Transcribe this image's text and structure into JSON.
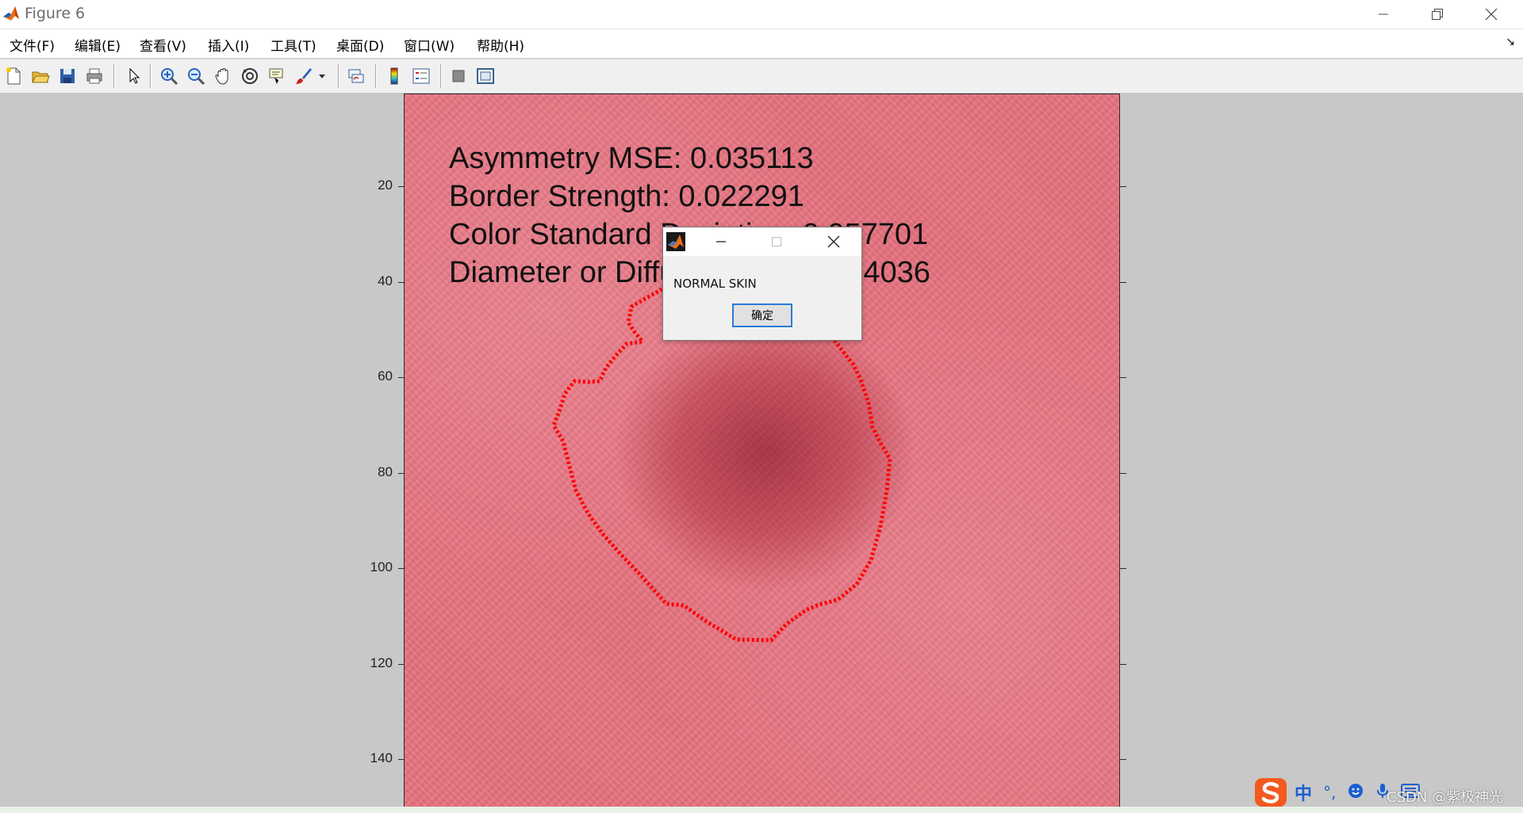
{
  "window": {
    "title": "Figure 6",
    "controls": [
      "minimize",
      "restore",
      "close"
    ]
  },
  "menu": {
    "items": [
      "文件(F)",
      "编辑(E)",
      "查看(V)",
      "插入(I)",
      "工具(T)",
      "桌面(D)",
      "窗口(W)",
      "帮助(H)"
    ],
    "dock_glyph": "↘"
  },
  "toolbar": {
    "icons": [
      "new-figure-icon",
      "open-file-icon",
      "save-icon",
      "print-icon",
      "edit-plot-arrow-icon",
      "zoom-in-icon",
      "zoom-out-icon",
      "pan-hand-icon",
      "rotate-3d-icon",
      "data-cursor-icon",
      "brush-icon",
      "brush-dropdown-icon",
      "link-plot-icon",
      "colorbar-icon",
      "legend-icon",
      "hide-plot-tools-icon",
      "show-plot-tools-icon"
    ]
  },
  "figure": {
    "overlay_lines": [
      "Asymmetry MSE: 0.035113",
      "Border Strength: 0.022291",
      "Color Standard Deviation: 0.057701",
      "Diameter or Diffusion Texture1.4036"
    ],
    "y_ticks": [
      "20",
      "40",
      "60",
      "80",
      "100",
      "120",
      "140"
    ],
    "y_tick_values": [
      20,
      40,
      60,
      80,
      100,
      120,
      140
    ],
    "boundary_color": "#ff0000"
  },
  "dialog": {
    "message": "NORMAL SKIN",
    "ok_label": "确定"
  },
  "ime": {
    "mode_label": "中",
    "punct_label": "°,",
    "watermark": "CSDN @紫极神光"
  }
}
